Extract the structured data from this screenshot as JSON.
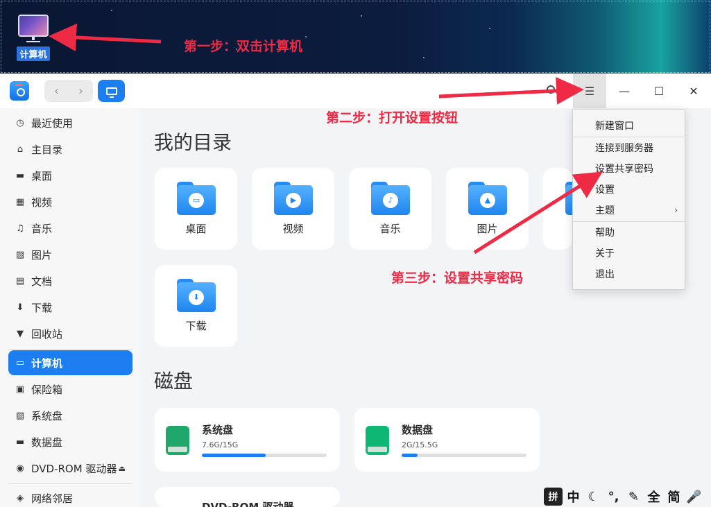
{
  "desktop": {
    "computer_label": "计算机"
  },
  "annotations": {
    "step1": "第一步：双击计算机",
    "step2": "第二步：打开设置按钮",
    "step3": "第三步：设置共享密码",
    "color": "#ee2a44"
  },
  "titlebar": {
    "back_icon": "chevron-left-icon",
    "forward_icon": "chevron-right-icon",
    "menu_icon": "hamburger-icon",
    "back_glyph": "‹",
    "forward_glyph": "›",
    "menu_glyph": "☰",
    "minimize_glyph": "—",
    "maximize_glyph": "☐",
    "close_glyph": "✕"
  },
  "sidebar": {
    "items": [
      {
        "label": "最近使用",
        "icon": "clock-icon",
        "glyph": "◷"
      },
      {
        "label": "主目录",
        "icon": "home-icon",
        "glyph": "⌂"
      },
      {
        "label": "桌面",
        "icon": "desktop-icon",
        "glyph": "▬"
      },
      {
        "label": "视频",
        "icon": "film-icon",
        "glyph": "▦"
      },
      {
        "label": "音乐",
        "icon": "music-icon",
        "glyph": "♫"
      },
      {
        "label": "图片",
        "icon": "image-icon",
        "glyph": "▨"
      },
      {
        "label": "文档",
        "icon": "document-icon",
        "glyph": "▤"
      },
      {
        "label": "下载",
        "icon": "download-icon",
        "glyph": "⬇"
      },
      {
        "label": "回收站",
        "icon": "trash-icon",
        "glyph": "▼"
      },
      {
        "label": "计算机",
        "icon": "computer-icon",
        "glyph": "▭"
      },
      {
        "label": "保险箱",
        "icon": "safe-icon",
        "glyph": "▣"
      },
      {
        "label": "系统盘",
        "icon": "disk-icon",
        "glyph": "▧"
      },
      {
        "label": "数据盘",
        "icon": "disk-icon",
        "glyph": "▬"
      },
      {
        "label": "DVD-ROM 驱动器",
        "icon": "dvd-icon",
        "glyph": "◉"
      },
      {
        "label": "网络邻居",
        "icon": "network-icon",
        "glyph": "◈"
      }
    ],
    "eject_glyph": "⏏"
  },
  "main": {
    "my_dirs_title": "我的目录",
    "folders": [
      {
        "label": "桌面",
        "badge": "▭"
      },
      {
        "label": "视频",
        "badge": "▶"
      },
      {
        "label": "音乐",
        "badge": "♪"
      },
      {
        "label": "图片",
        "badge": "▲"
      },
      {
        "label": "下载",
        "badge": "⬇"
      }
    ],
    "disks_title": "磁盘",
    "disks": [
      {
        "name": "系统盘",
        "size": "7.6G/15G",
        "used_fraction": 0.51,
        "color": "#1fa86a"
      },
      {
        "name": "数据盘",
        "size": "2G/15.5G",
        "used_fraction": 0.13,
        "color": "#0fb774"
      },
      {
        "name": "DVD-ROM 驱动器",
        "size": "",
        "used_fraction": 0,
        "color": "#1c7ef0"
      }
    ]
  },
  "menu": {
    "items": [
      "新建窗口",
      "连接到服务器",
      "设置共享密码",
      "设置",
      "主题",
      "帮助",
      "关于",
      "退出"
    ],
    "submenu_glyph": "›"
  },
  "ime": {
    "items": [
      "拼",
      "中",
      "☾",
      "°,",
      "✎",
      "全",
      "简",
      "🎤"
    ]
  },
  "colors": {
    "accent": "#1c7ef0",
    "annotation": "#ee2a44"
  }
}
